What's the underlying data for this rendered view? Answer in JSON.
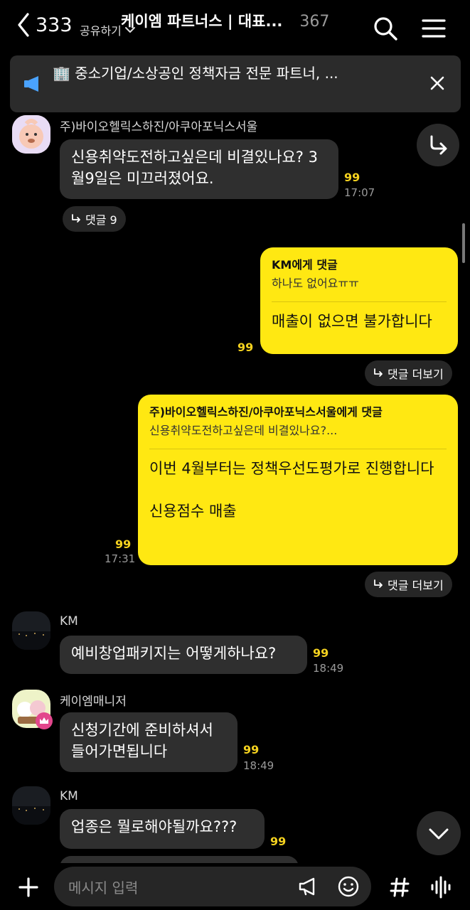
{
  "header": {
    "back_count": "333",
    "title": "케이엠 파트너스 | 대표...",
    "member_count": "367",
    "share_label": "공유하기"
  },
  "notice": {
    "text": "🏢 중소기업/소상공인 정책자금 전문 파트너, ..."
  },
  "messages": [
    {
      "sender": "주)바이오헬릭스하진/아쿠아포닉스서울",
      "text": "신용취약도전하고싶은데 비결있나요? 3월9일은 미끄러졌어요.",
      "read": "99",
      "time": "17:07",
      "reply_label": "댓글 9"
    },
    {
      "reply_to": "KM에게 댓글",
      "quote": "하나도 없어요ㅠㅠ",
      "text": "매출이 없으면 불가합니다",
      "read": "99",
      "more_label": "댓글 더보기"
    },
    {
      "reply_to": "주)바이오헬릭스하진/아쿠아포닉스서울에게 댓글",
      "quote": "신용취약도전하고싶은데 비결있나요?...",
      "text": "이번 4월부터는 정책우선도평가로 진행합니다\n\n신용점수 매출",
      "read": "99",
      "time": "17:31",
      "more_label": "댓글 더보기"
    },
    {
      "sender": "KM",
      "text": "예비창업패키지는 어떻게하나요?",
      "read": "99",
      "time": "18:49"
    },
    {
      "sender": "케이엠매니저",
      "text": "신청기간에 준비하셔서 들어가면됩니다",
      "read": "99",
      "time": "18:49"
    },
    {
      "sender": "KM",
      "text": "업종은 뭘로해야될까요???",
      "read": "99"
    }
  ],
  "input": {
    "placeholder": "메시지 입력"
  },
  "colors": {
    "accent_yellow": "#ffe812",
    "read_count": "#f5d21f",
    "bubble_dark": "#2f2f2f",
    "notice_icon": "#4aa3ff"
  }
}
